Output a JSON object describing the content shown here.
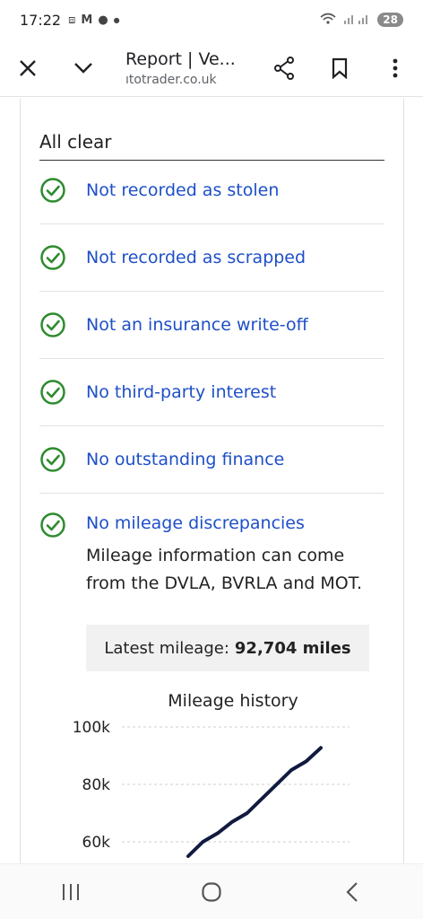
{
  "status": {
    "time": "17:22",
    "notification_icons": [
      "screenshot-icon",
      "gmail-icon",
      "chat-icon",
      "dot-icon"
    ],
    "battery": "28"
  },
  "toolbar": {
    "title": "Report | Ve...",
    "url": "ıtotrader.co.uk"
  },
  "section": {
    "title": "All clear"
  },
  "checks": [
    {
      "label": "Not recorded as stolen"
    },
    {
      "label": "Not recorded as scrapped"
    },
    {
      "label": "Not an insurance write-off"
    },
    {
      "label": "No third-party interest"
    },
    {
      "label": "No outstanding finance"
    },
    {
      "label": "No mileage discrepancies"
    }
  ],
  "mileage": {
    "note": "Mileage information can come from the DVLA, BVRLA and MOT.",
    "latest_label": "Latest mileage:",
    "latest_value": "92,704 miles"
  },
  "colors": {
    "check_green": "#2e8b2e",
    "link_blue": "#1e4fc8",
    "line_navy": "#111a3f"
  },
  "chart_data": {
    "type": "line",
    "title": "Mileage history",
    "xlabel": "",
    "ylabel": "",
    "y_ticks": [
      "100k",
      "80k",
      "60k"
    ],
    "ylim": [
      55000,
      100000
    ],
    "series": [
      {
        "values": [
          55000,
          60000,
          63000,
          67000,
          70000,
          75000,
          80000,
          85000,
          88000,
          92704
        ]
      }
    ],
    "grid": true
  }
}
